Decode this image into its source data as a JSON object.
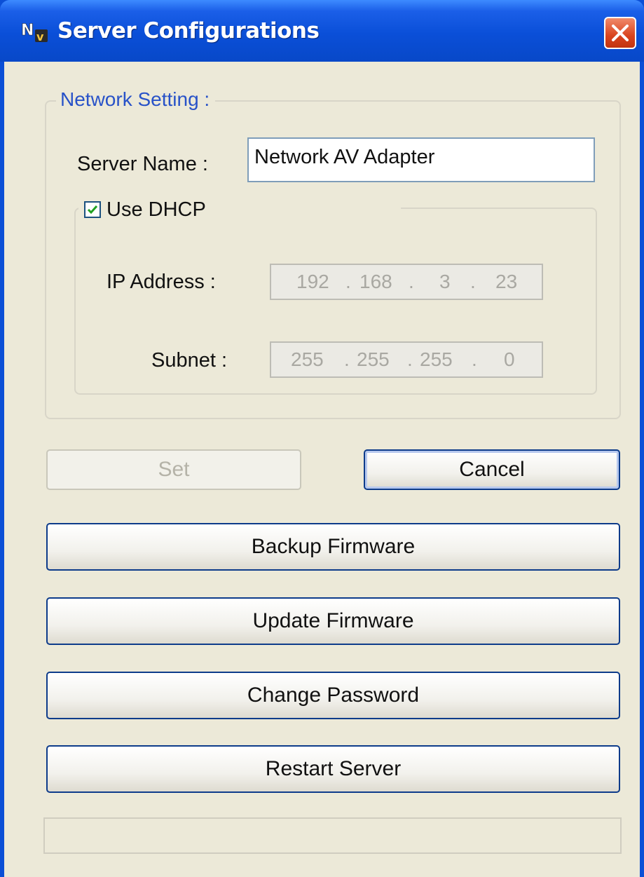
{
  "window": {
    "title": "Server Configurations",
    "app_icon_text": "Nv",
    "colors": {
      "title_bar": "#0a4fd8",
      "client_bg": "#ece9d8",
      "close_button": "#d9431e",
      "group_title": "#2852c8"
    }
  },
  "network_setting": {
    "group_title": "Network Setting :",
    "server_name_label": "Server Name :",
    "server_name_value": "Network AV Adapter",
    "use_dhcp_label": "Use DHCP",
    "use_dhcp_checked": true,
    "ip_address_label": "IP Address :",
    "ip_address": [
      "192",
      "168",
      "3",
      "23"
    ],
    "subnet_label": "Subnet :",
    "subnet": [
      "255",
      "255",
      "255",
      "0"
    ]
  },
  "buttons": {
    "set": "Set",
    "cancel": "Cancel",
    "backup_firmware": "Backup Firmware",
    "update_firmware": "Update Firmware",
    "change_password": "Change Password",
    "restart_server": "Restart Server"
  },
  "progress": {
    "value": 0
  }
}
